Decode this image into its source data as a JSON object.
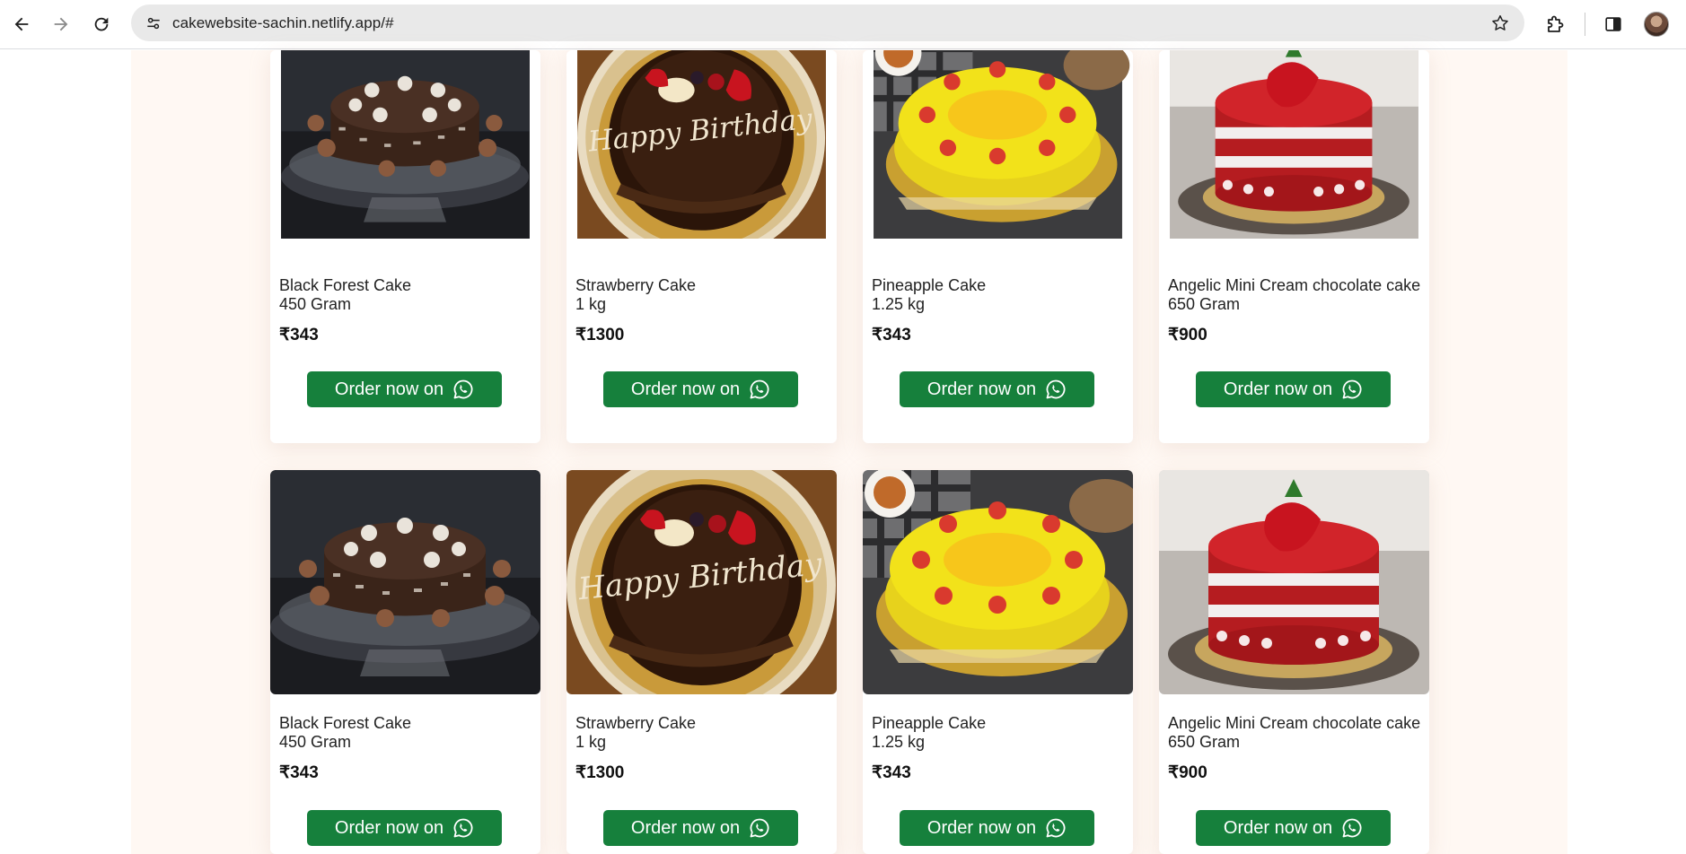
{
  "browser": {
    "url": "cakewebsite-sachin.netlify.app/#"
  },
  "products": [
    {
      "name": "Black Forest Cake",
      "weight": "450 Gram",
      "price": "₹343",
      "button": "Order now on",
      "image": "black-forest-cake-image"
    },
    {
      "name": "Strawberry Cake",
      "weight": "1 kg",
      "price": "₹1300",
      "button": "Order now on",
      "image": "strawberry-cake-image"
    },
    {
      "name": "Pineapple Cake",
      "weight": "1.25 kg",
      "price": "₹343",
      "button": "Order now on",
      "image": "pineapple-cake-image"
    },
    {
      "name": "Angelic Mini Cream chocolate cake",
      "weight": "650 Gram",
      "price": "₹900",
      "button": "Order now on",
      "image": "red-velvet-cake-image"
    }
  ],
  "colors": {
    "accent": "#16803c",
    "page_bg": "#fff8f3"
  }
}
